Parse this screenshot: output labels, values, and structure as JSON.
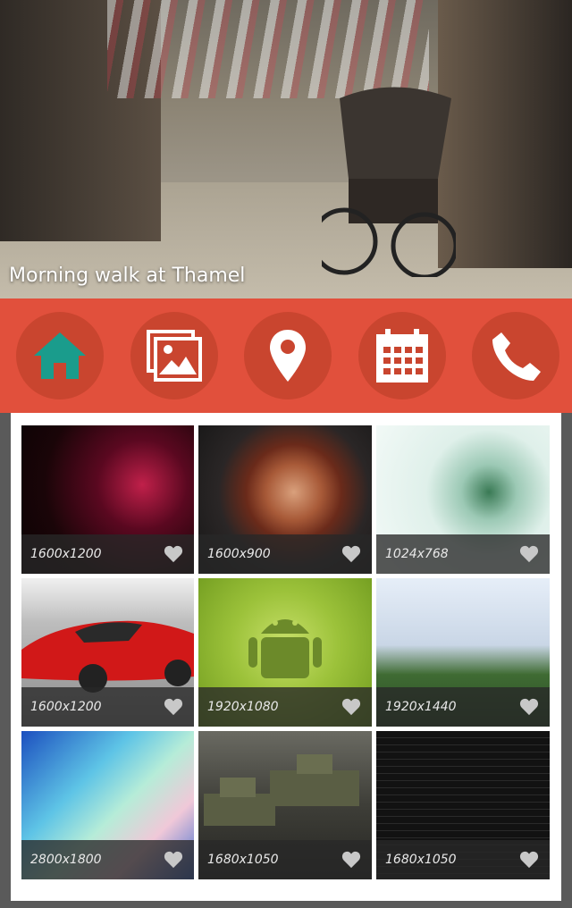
{
  "hero": {
    "caption": "Morning walk at Thamel"
  },
  "nav": {
    "items": [
      {
        "name": "home",
        "icon": "home-icon",
        "color": "#1a9c8c"
      },
      {
        "name": "gallery",
        "icon": "image-gallery-icon",
        "color": "#ffffff"
      },
      {
        "name": "location",
        "icon": "map-pin-icon",
        "color": "#ffffff"
      },
      {
        "name": "calendar",
        "icon": "calendar-icon",
        "color": "#ffffff"
      },
      {
        "name": "phone",
        "icon": "phone-icon",
        "color": "#ffffff"
      }
    ],
    "bar_color": "#e1503c",
    "button_color": "#c9452f"
  },
  "gallery": {
    "tiles": [
      {
        "resolution": "1600x1200",
        "icon": "heart-icon"
      },
      {
        "resolution": "1600x900",
        "icon": "heart-icon"
      },
      {
        "resolution": "1024x768",
        "icon": "heart-icon"
      },
      {
        "resolution": "1600x1200",
        "icon": "heart-icon"
      },
      {
        "resolution": "1920x1080",
        "icon": "heart-icon"
      },
      {
        "resolution": "1920x1440",
        "icon": "heart-icon"
      },
      {
        "resolution": "2800x1800",
        "icon": "heart-icon"
      },
      {
        "resolution": "1680x1050",
        "icon": "heart-icon"
      },
      {
        "resolution": "1680x1050",
        "icon": "heart-icon"
      }
    ]
  }
}
